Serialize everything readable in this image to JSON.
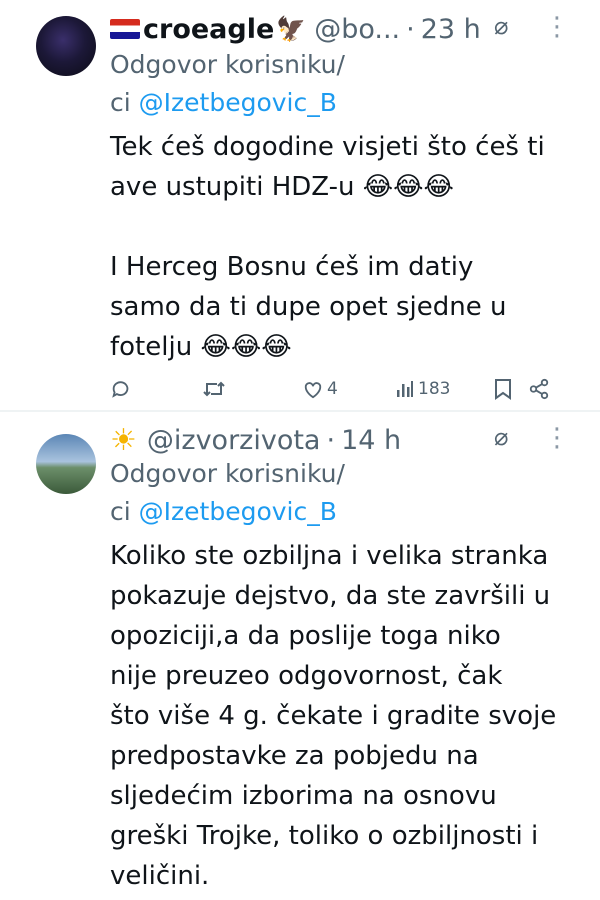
{
  "tweets": [
    {
      "display_name": "croeagle",
      "handle": "@bo...",
      "separator": "·",
      "time": "23 h",
      "reply_prefix": "Odgovor korisniku/",
      "reply_prefix2": "ci",
      "reply_mention": "@Izetbegovic_B",
      "body_lines": [
        "Tek ćeš dogodine visjeti što ćeš ti",
        "ave ustupiti HDZ-u 😂😂😂",
        "",
        "I Herceg Bosnu ćeš im datiy",
        "samo da ti dupe opet sjedne u",
        "fotelju 😂😂😂"
      ],
      "likes": "4",
      "views": "183",
      "icons": [
        "croatia-flag-icon",
        "eagle-icon",
        "grok-icon",
        "more-icon",
        "reply-icon",
        "retweet-icon",
        "like-icon",
        "views-icon",
        "bookmark-icon",
        "share-icon"
      ]
    },
    {
      "handle": "@izvorzivota",
      "separator": "·",
      "time": "14 h",
      "reply_prefix": "Odgovor korisniku/",
      "reply_prefix2": "ci",
      "reply_mention": "@Izetbegovic_B",
      "body_lines": [
        "Koliko ste ozbiljna i velika stranka",
        "pokazuje dejstvo, da ste završili u",
        "opoziciji,a da poslije toga niko",
        "nije preuzeo odgovornost, čak",
        "što više 4 g. čekate i gradite svoje",
        "predpostavke za pobjedu na",
        "sljedećim izborima na osnovu",
        "greški Trojke, toliko o ozbiljnosti i",
        "veličini."
      ],
      "icons": [
        "sun-icon",
        "grok-icon",
        "more-icon"
      ]
    }
  ],
  "colors": {
    "text": "#0f1419",
    "muted": "#536471",
    "link": "#1d9bf0",
    "divider": "#eff3f4"
  }
}
